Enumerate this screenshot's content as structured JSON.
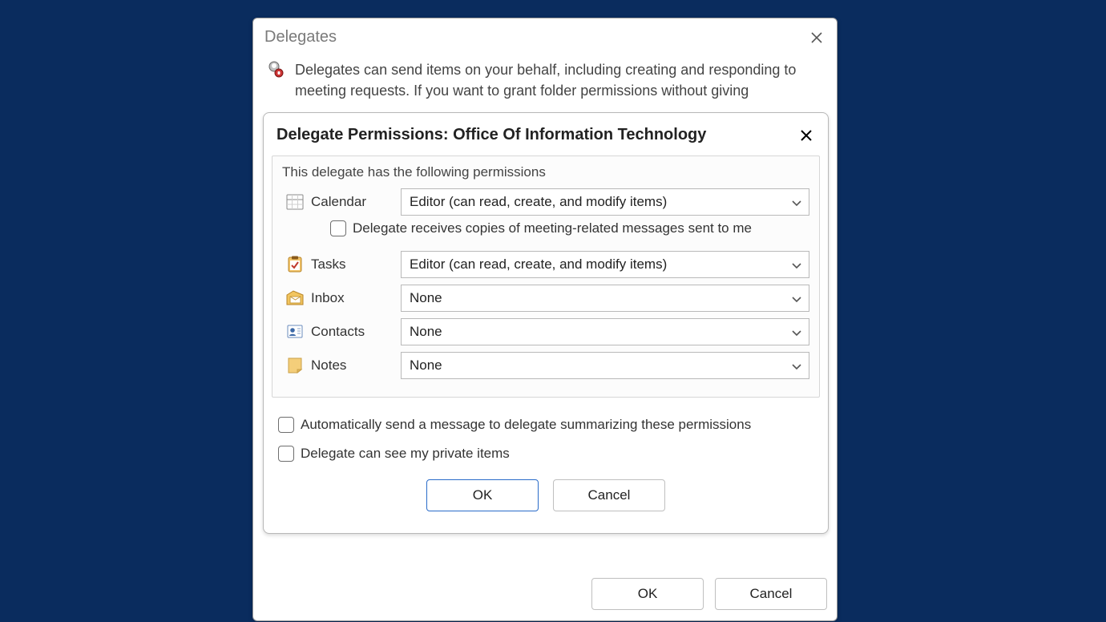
{
  "outer": {
    "title": "Delegates",
    "description": "Delegates can send items on your behalf, including creating and responding to meeting requests. If you want to grant folder permissions without giving",
    "ok_label": "OK",
    "cancel_label": "Cancel"
  },
  "inner": {
    "title": "Delegate Permissions: Office Of Information Technology",
    "heading": "This delegate has the following permissions",
    "rows": {
      "calendar": {
        "label": "Calendar",
        "value": "Editor (can read, create, and modify items)"
      },
      "tasks": {
        "label": "Tasks",
        "value": "Editor (can read, create, and modify items)"
      },
      "inbox": {
        "label": "Inbox",
        "value": "None"
      },
      "contacts": {
        "label": "Contacts",
        "value": "None"
      },
      "notes": {
        "label": "Notes",
        "value": "None"
      }
    },
    "checkboxes": {
      "meeting_copies": "Delegate receives copies of meeting-related messages sent to me",
      "auto_send_summary": "Automatically send a message to delegate summarizing these permissions",
      "see_private": "Delegate can see my private items"
    },
    "ok_label": "OK",
    "cancel_label": "Cancel"
  }
}
